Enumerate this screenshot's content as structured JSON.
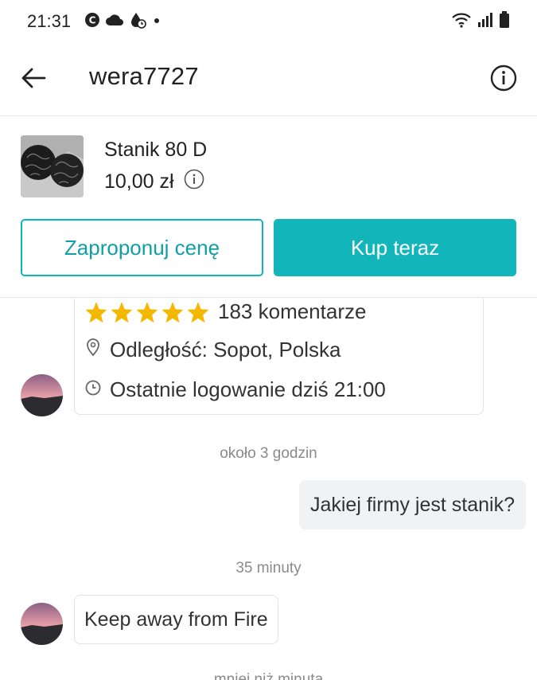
{
  "status_bar": {
    "time": "21:31",
    "left_icons": [
      "c-badge-icon",
      "cloud-icon",
      "water-drop-clock-icon",
      "dot-icon"
    ],
    "right_icons": [
      "wifi-icon",
      "signal-icon",
      "battery-icon"
    ]
  },
  "header": {
    "back_icon": "arrow-left-icon",
    "username": "wera7727",
    "info_icon": "info-circle-icon"
  },
  "item": {
    "title": "Stanik 80 D",
    "price": "10,00 zł",
    "offer_button": "Zaproponuj cenę",
    "buy_button": "Kup teraz"
  },
  "profile_card": {
    "rating_stars": 5,
    "reviews": "183 komentarze",
    "location": "Odległość: Sopot, Polska",
    "last_login": "Ostatnie logowanie dziś 21:00"
  },
  "messages": [
    {
      "type": "timestamp",
      "text": "około   3 godzin"
    },
    {
      "type": "outgoing",
      "text": "Jakiej firmy jest stanik?"
    },
    {
      "type": "timestamp",
      "text": "35 minuty"
    },
    {
      "type": "incoming",
      "text": "Keep away from Fire"
    },
    {
      "type": "timestamp",
      "text": "mniej niż minuta"
    }
  ],
  "colors": {
    "accent": "#12b6ba",
    "star": "#f5b800",
    "timestamp": "#8a8a8a"
  }
}
